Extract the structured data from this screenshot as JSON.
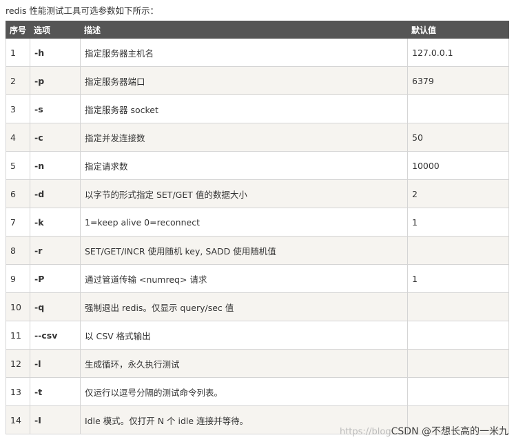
{
  "intro": "redis 性能测试工具可选参数如下所示：",
  "table": {
    "headers": [
      "序号",
      "选项",
      "描述",
      "默认值"
    ],
    "rows": [
      {
        "no": "1",
        "opt": "-h",
        "desc": "指定服务器主机名",
        "def": "127.0.0.1"
      },
      {
        "no": "2",
        "opt": "-p",
        "desc": "指定服务器端口",
        "def": "6379"
      },
      {
        "no": "3",
        "opt": "-s",
        "desc": "指定服务器 socket",
        "def": ""
      },
      {
        "no": "4",
        "opt": "-c",
        "desc": "指定并发连接数",
        "def": "50"
      },
      {
        "no": "5",
        "opt": "-n",
        "desc": "指定请求数",
        "def": "10000"
      },
      {
        "no": "6",
        "opt": "-d",
        "desc": "以字节的形式指定 SET/GET 值的数据大小",
        "def": "2"
      },
      {
        "no": "7",
        "opt": "-k",
        "desc": "1=keep alive 0=reconnect",
        "def": "1"
      },
      {
        "no": "8",
        "opt": "-r",
        "desc": "SET/GET/INCR 使用随机 key, SADD 使用随机值",
        "def": ""
      },
      {
        "no": "9",
        "opt": "-P",
        "desc": "通过管道传输 <numreq> 请求",
        "def": "1"
      },
      {
        "no": "10",
        "opt": "-q",
        "desc": "强制退出 redis。仅显示 query/sec 值",
        "def": ""
      },
      {
        "no": "11",
        "opt": "--csv",
        "desc": "以 CSV 格式输出",
        "def": ""
      },
      {
        "no": "12",
        "opt": "-l",
        "desc": "生成循环，永久执行测试",
        "def": ""
      },
      {
        "no": "13",
        "opt": "-t",
        "desc": "仅运行以逗号分隔的测试命令列表。",
        "def": ""
      },
      {
        "no": "14",
        "opt": "-I",
        "desc": "Idle 模式。仅打开 N 个 idle 连接并等待。",
        "def": ""
      }
    ]
  },
  "watermark": {
    "url": "https://blog",
    "text": "CSDN @不想长高的一米九"
  }
}
